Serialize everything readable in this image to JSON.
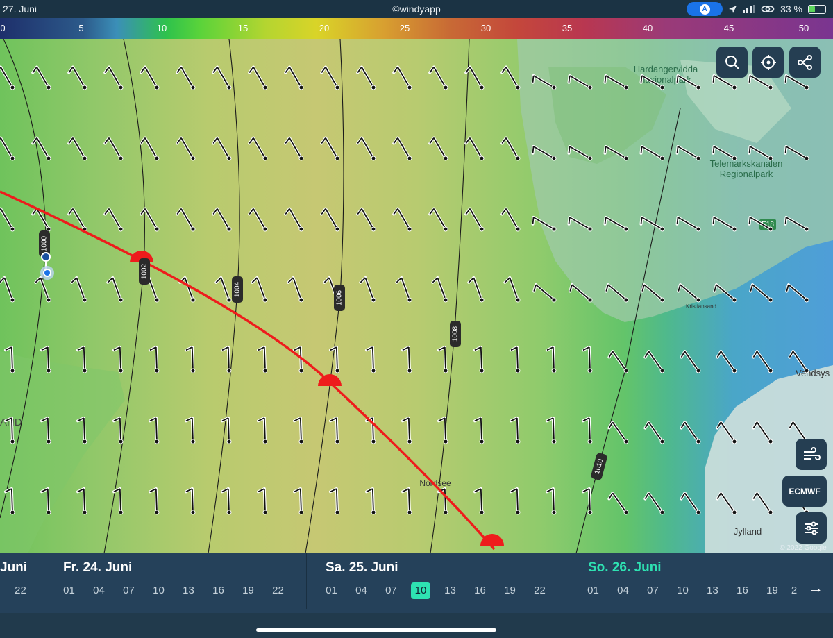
{
  "status": {
    "date": "27. Juni",
    "center": "©windyapp",
    "location_pill": "A",
    "battery": "33 %"
  },
  "scale": {
    "values": [
      "0",
      "5",
      "10",
      "15",
      "20",
      "25",
      "30",
      "35",
      "40",
      "45",
      "50"
    ]
  },
  "map": {
    "labels": {
      "hardangervidda": "Hardangervidda\nnasjonalpark",
      "telemark": "Telemarkskanalen\nRegionalpark",
      "e18": "E18",
      "kristiansand": "Kristiansand",
      "vendsys": "Vendsys",
      "jylland": "Jylland",
      "nordsee": "Nordsee",
      "land": "AND",
      "copyright": "© 2022 Google"
    },
    "isobars": [
      "1000",
      "1002",
      "1004",
      "1006",
      "1008",
      "1010"
    ],
    "model_label": "ECMWF"
  },
  "timeline": {
    "prev_day": {
      "label": "Juni",
      "hours": [
        "22"
      ]
    },
    "days": [
      {
        "label": "Fr. 24. Juni",
        "hours": [
          "01",
          "04",
          "07",
          "10",
          "13",
          "16",
          "19",
          "22"
        ]
      },
      {
        "label": "Sa. 25. Juni",
        "hours": [
          "01",
          "04",
          "07",
          "10",
          "13",
          "16",
          "19",
          "22"
        ]
      },
      {
        "label": "So. 26. Juni",
        "hours": [
          "01",
          "04",
          "07",
          "10",
          "13",
          "16",
          "19",
          "2"
        ]
      }
    ],
    "selected_hour": "10",
    "next_arrow": "→"
  },
  "colors": {
    "accent": "#2ee2b2",
    "track": "#ee1c1c",
    "panel": "#25415a"
  }
}
